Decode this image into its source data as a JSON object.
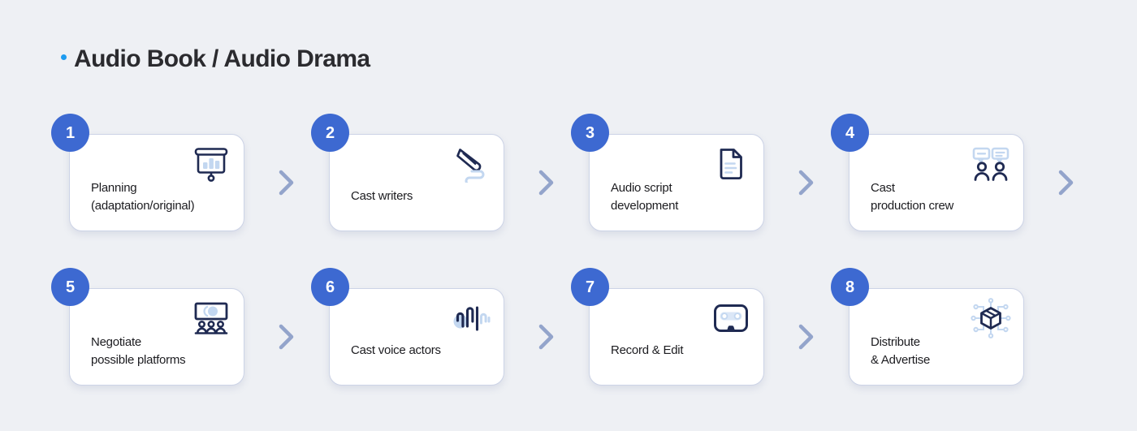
{
  "header": {
    "bullet_color": "#1d9bf0",
    "title": "Audio Book / Audio Drama"
  },
  "theme": {
    "background": "#eef0f4",
    "card_background": "#ffffff",
    "card_border": "#ccd3e6",
    "badge_color": "#3d69d1",
    "icon_dark": "#1f2a52",
    "icon_light": "#c3d7f0",
    "arrow_color": "#93a4cb",
    "text_color": "#1c1c20"
  },
  "flow": {
    "rows": [
      {
        "steps": [
          {
            "number": "1",
            "icon": "presentation-chart-icon",
            "line1": "Planning",
            "line2": "(adaptation/original)"
          },
          {
            "number": "2",
            "icon": "pen-writing-icon",
            "line1": "Cast writers",
            "line2": ""
          },
          {
            "number": "3",
            "icon": "document-script-icon",
            "line1": "Audio script",
            "line2": "development"
          },
          {
            "number": "4",
            "icon": "people-speech-icon",
            "line1": "Cast",
            "line2": "production crew"
          }
        ],
        "arrows": [
          "chevron-right-icon",
          "chevron-right-icon",
          "chevron-right-icon",
          "chevron-right-icon"
        ]
      },
      {
        "steps": [
          {
            "number": "5",
            "icon": "screen-audience-icon",
            "line1": "Negotiate",
            "line2": "possible platforms"
          },
          {
            "number": "6",
            "icon": "sound-wave-icon",
            "line1": "Cast voice actors",
            "line2": ""
          },
          {
            "number": "7",
            "icon": "cassette-tape-icon",
            "line1": "Record & Edit",
            "line2": ""
          },
          {
            "number": "8",
            "icon": "package-network-icon",
            "line1": "Distribute",
            "line2": "& Advertise"
          }
        ],
        "arrows": [
          "chevron-right-icon",
          "chevron-right-icon",
          "chevron-right-icon"
        ]
      }
    ]
  }
}
